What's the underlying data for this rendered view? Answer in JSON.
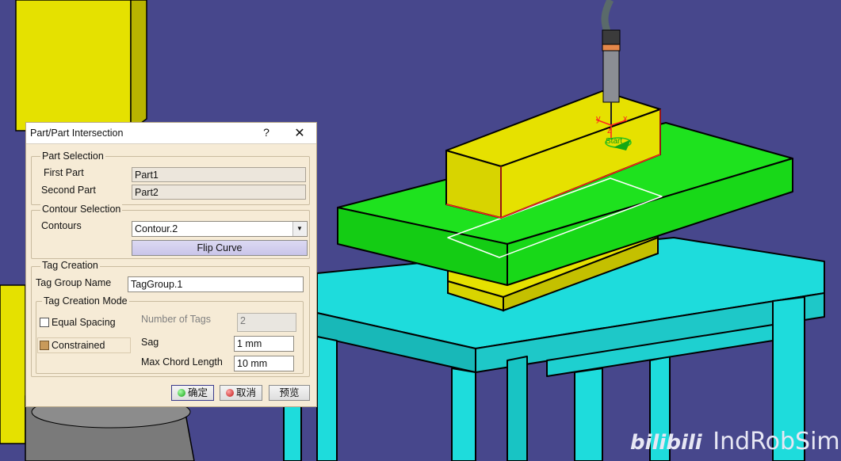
{
  "dialog": {
    "title": "Part/Part Intersection",
    "help": "?",
    "close": "✕",
    "part_selection": {
      "legend": "Part Selection",
      "first_label": "First Part",
      "first_value": "Part1",
      "second_label": "Second Part",
      "second_value": "Part2"
    },
    "contour_selection": {
      "legend": "Contour Selection",
      "contours_label": "Contours",
      "contours_value": "Contour.2",
      "dropdown_arrow": "▼",
      "flip_label": "Flip Curve"
    },
    "tag_creation": {
      "legend": "Tag Creation",
      "group_name_label": "Tag Group Name",
      "group_name_value": "TagGroup.1",
      "mode_legend": "Tag Creation Mode",
      "equal_spacing_label": "Equal Spacing",
      "equal_spacing_checked": false,
      "number_of_tags_label": "Number of Tags",
      "number_of_tags_value": "2",
      "constrained_label": "Constrained",
      "constrained_checked": true,
      "sag_label": "Sag",
      "sag_value": "1 mm",
      "max_chord_label": "Max Chord Length",
      "max_chord_value": "10 mm"
    },
    "buttons": {
      "ok": "确定",
      "cancel": "取消",
      "preview": "预览"
    }
  },
  "viewport": {
    "compass_labels": {
      "y": "y",
      "x": "x",
      "z": "z"
    },
    "start_label": "Start"
  },
  "watermark": {
    "logo": "bilibili",
    "text": "IndRobSim"
  },
  "colors": {
    "background": "#47478c",
    "yellow_part": "#e6e100",
    "green_plate": "#18e21a",
    "cyan_table": "#1edcdc",
    "dialog_bg": "#f6ebd6",
    "contour_red": "#ff2020"
  }
}
